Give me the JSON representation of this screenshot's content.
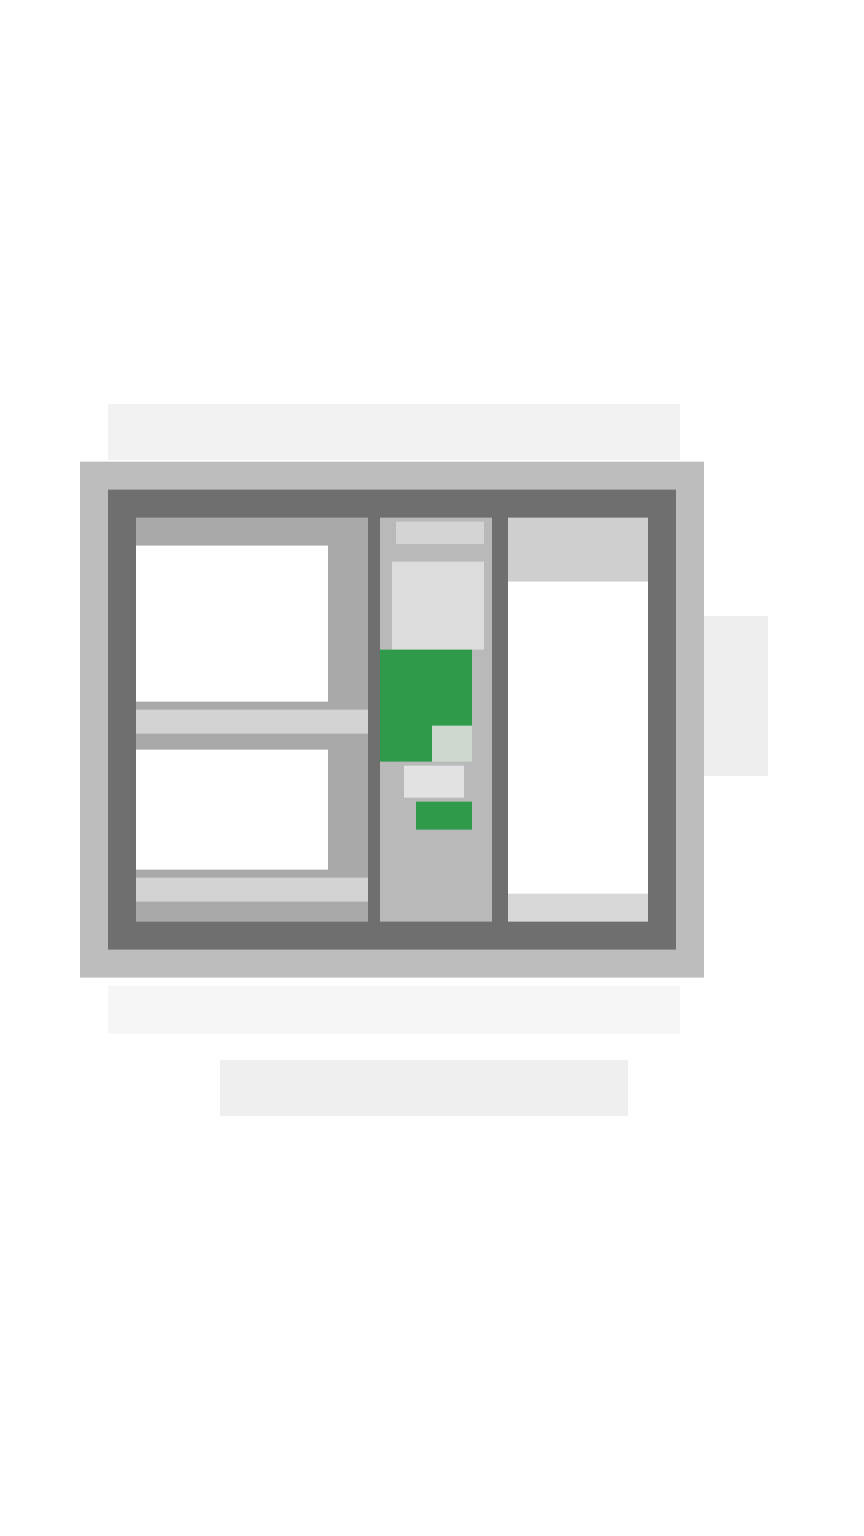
{
  "screen": {
    "theme": "light"
  },
  "colors": {
    "accent_green": "#2f9a49",
    "frame_dark": "#6f6f6f",
    "frame_mid": "#bdbdbd",
    "background": "#ffffff"
  },
  "illustration": {
    "icon": "kanban-board-illustration-icon"
  },
  "caption": {
    "text": ""
  }
}
